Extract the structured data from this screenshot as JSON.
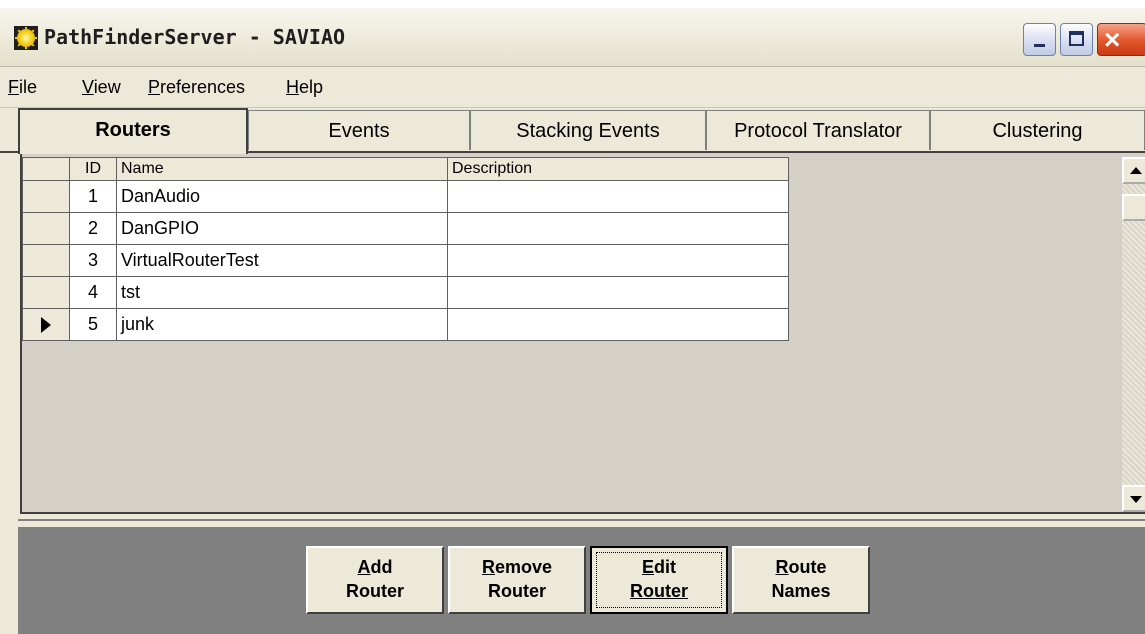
{
  "window": {
    "title": "PathFinderServer - SAVIAO",
    "controls": {
      "minimize": "_",
      "maximize": "□",
      "close": "×"
    }
  },
  "menu": [
    {
      "mnemonic": "F",
      "rest": "ile"
    },
    {
      "mnemonic": "V",
      "rest": "iew"
    },
    {
      "mnemonic": "P",
      "rest": "references"
    },
    {
      "mnemonic": "H",
      "rest": "elp"
    }
  ],
  "tabs": [
    {
      "label": "Routers",
      "active": true
    },
    {
      "label": "Events",
      "active": false
    },
    {
      "label": "Stacking Events",
      "active": false
    },
    {
      "label": "Protocol Translator",
      "active": false
    },
    {
      "label": "Clustering",
      "active": false
    }
  ],
  "grid": {
    "columns": [
      "ID",
      "Name",
      "Description"
    ],
    "rows": [
      {
        "id": "1",
        "name": "DanAudio",
        "description": "",
        "current": false
      },
      {
        "id": "2",
        "name": "DanGPIO",
        "description": "",
        "current": false
      },
      {
        "id": "3",
        "name": "VirtualRouterTest",
        "description": "",
        "current": false
      },
      {
        "id": "4",
        "name": "tst",
        "description": "",
        "current": false
      },
      {
        "id": "5",
        "name": "junk",
        "description": "",
        "current": true
      }
    ]
  },
  "buttons": [
    {
      "mnemonic": "A",
      "line1_rest": "dd",
      "line2": "Router",
      "focused": false
    },
    {
      "mnemonic": "R",
      "line1_rest": "emove",
      "line2": "Router",
      "focused": false
    },
    {
      "mnemonic": "E",
      "line1_rest": "dit",
      "line2": "Router",
      "focused": true
    },
    {
      "mnemonic": "R",
      "line1_rest": "oute",
      "line2": "Names",
      "focused": false
    }
  ]
}
